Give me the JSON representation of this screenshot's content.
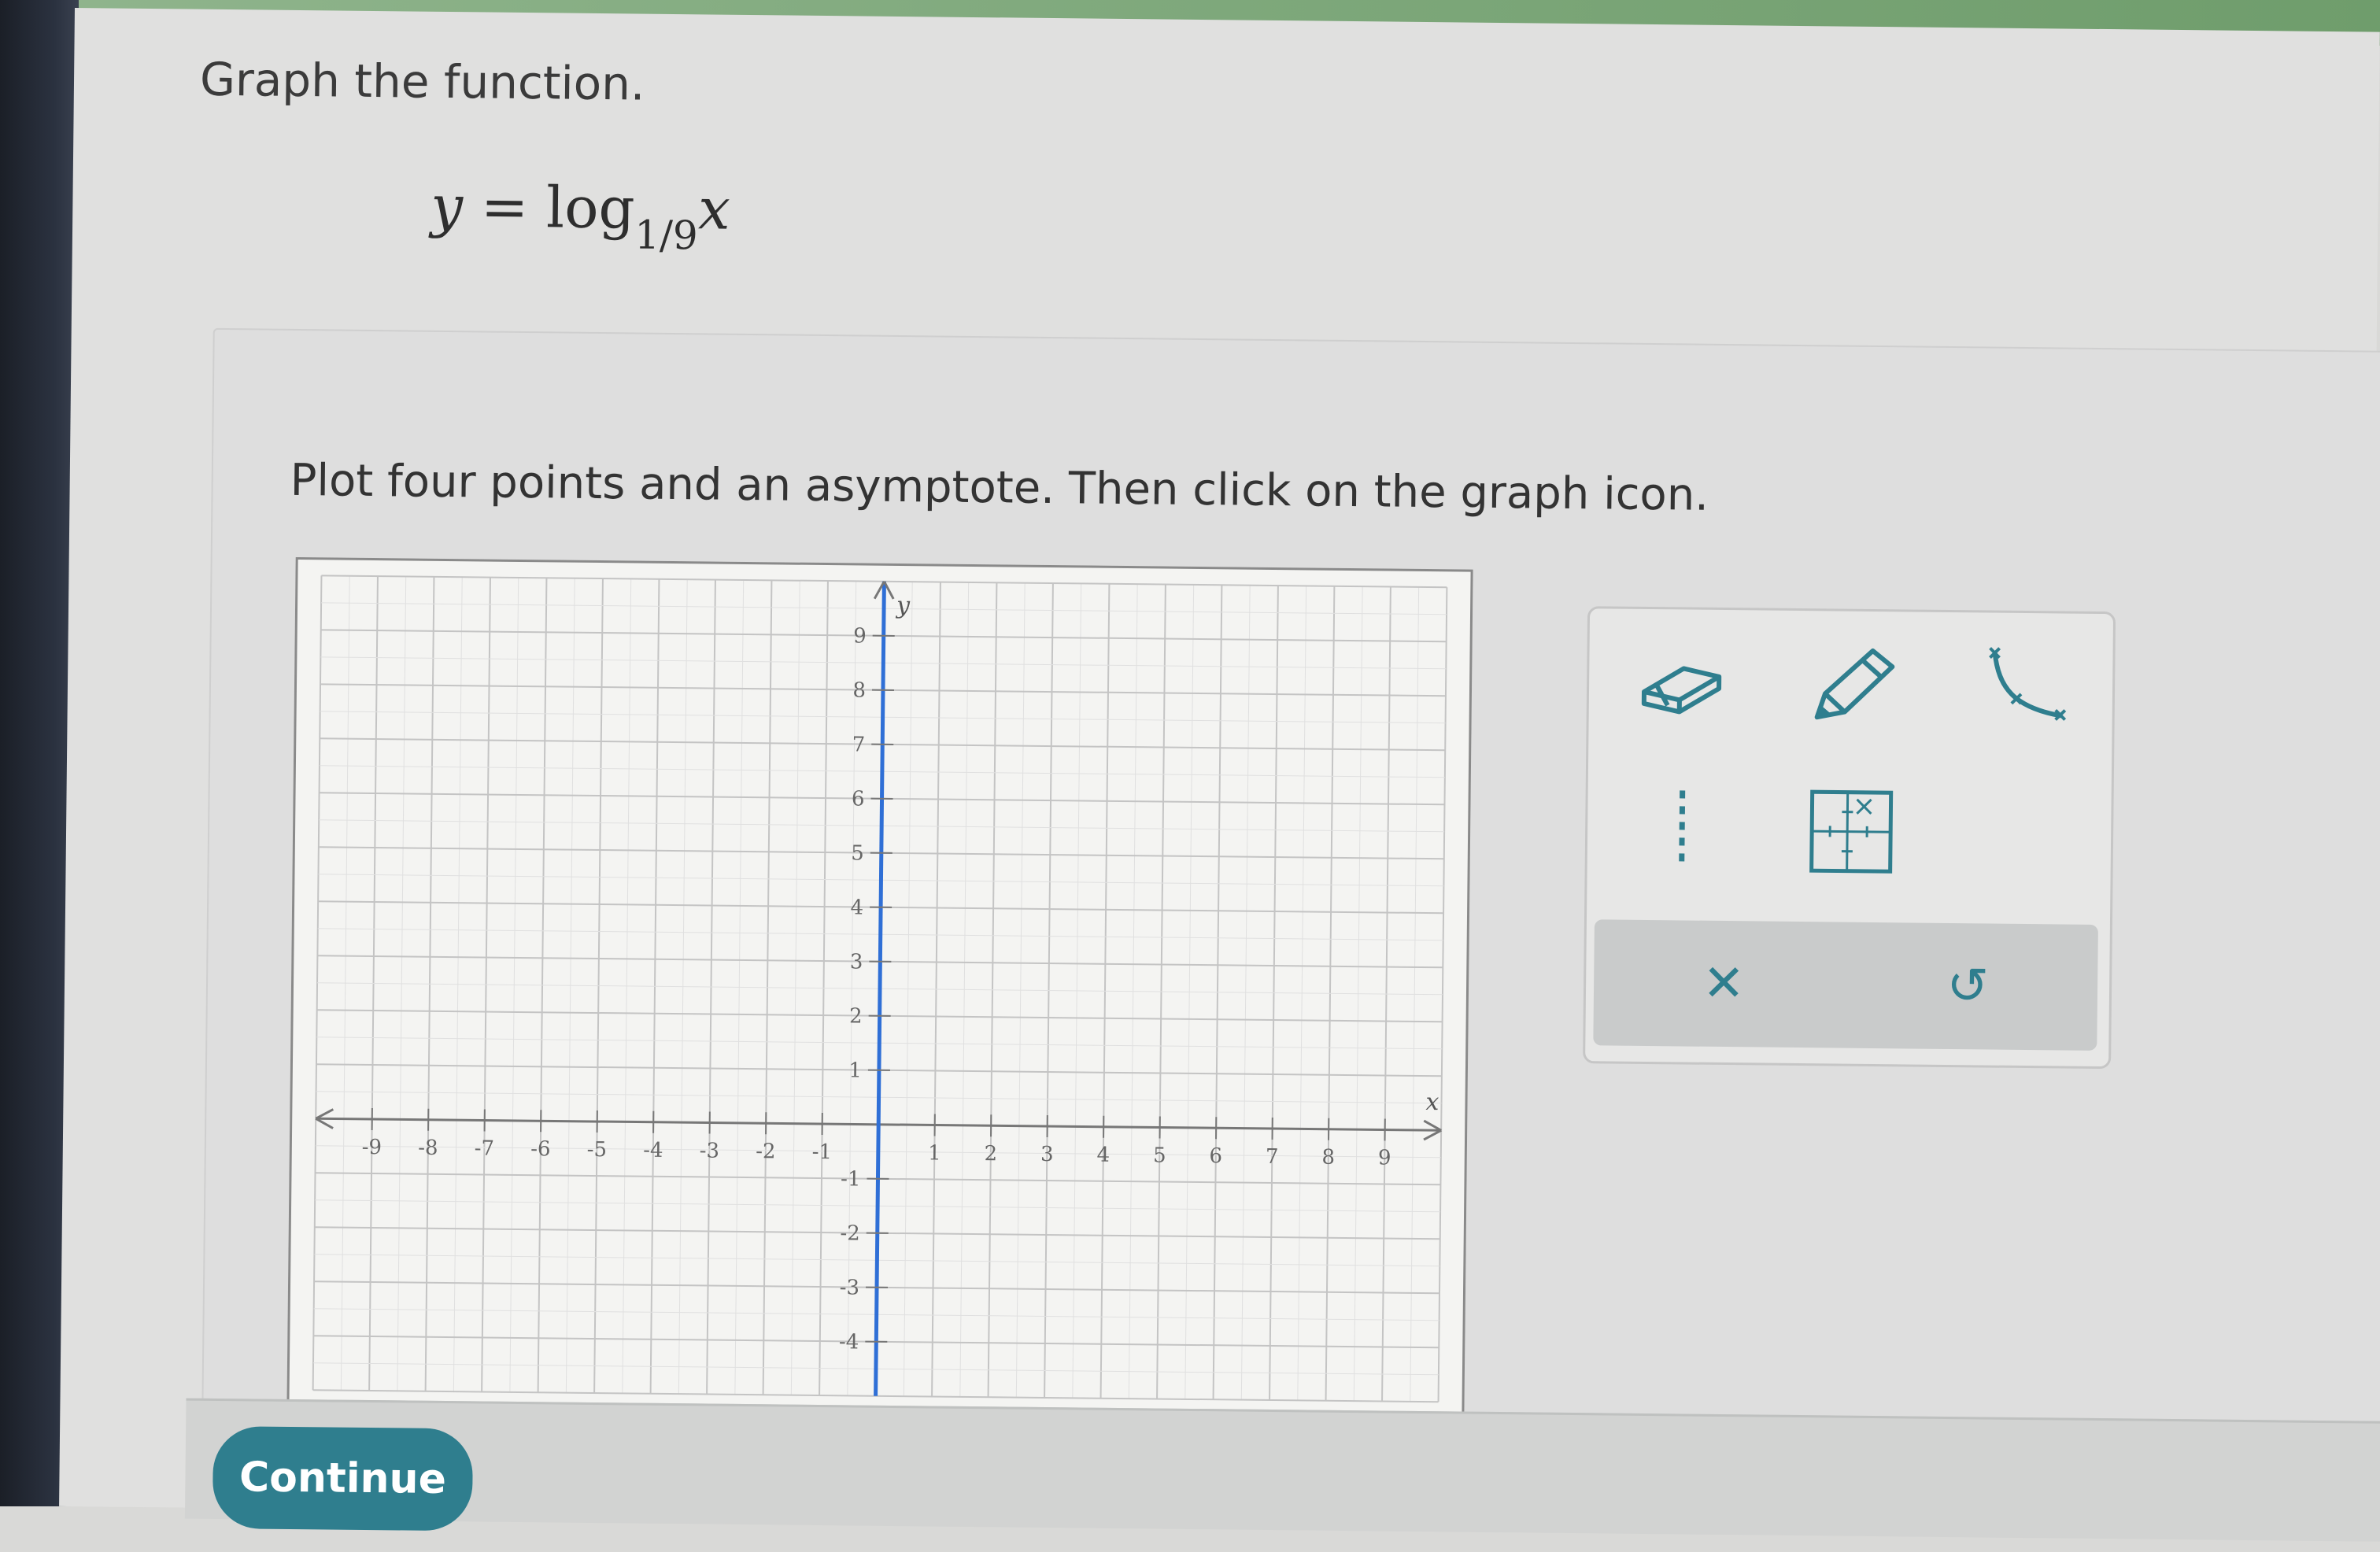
{
  "question": {
    "title": "Graph the function.",
    "function_parts": {
      "y": "y",
      "equals": "=",
      "log": "log",
      "base": "1/9",
      "arg": "x"
    },
    "instruction": "Plot four points and an asymptote. Then click on the graph icon."
  },
  "graph": {
    "x_axis_label": "x",
    "y_axis_label": "y",
    "x_range": [
      -10,
      10
    ],
    "y_range": [
      -5,
      10
    ],
    "x_ticks": [
      -9,
      -8,
      -7,
      -6,
      -5,
      -4,
      -3,
      -2,
      -1,
      1,
      2,
      3,
      4,
      5,
      6,
      7,
      8,
      9
    ],
    "y_ticks": [
      9,
      8,
      7,
      6,
      5,
      4,
      3,
      2,
      1,
      -1,
      -2,
      -3,
      -4
    ],
    "y_axis_color": "#2f6fd6",
    "grid": true
  },
  "toolbox": {
    "tools": [
      "eraser-icon",
      "pencil-icon",
      "log-curve-icon",
      "asymptote-icon",
      "graph-icon"
    ],
    "clear_glyph": "✕",
    "undo_glyph": "↺",
    "icon_color": "#2f7e8e"
  },
  "footer": {
    "continue_label": "Continue"
  }
}
